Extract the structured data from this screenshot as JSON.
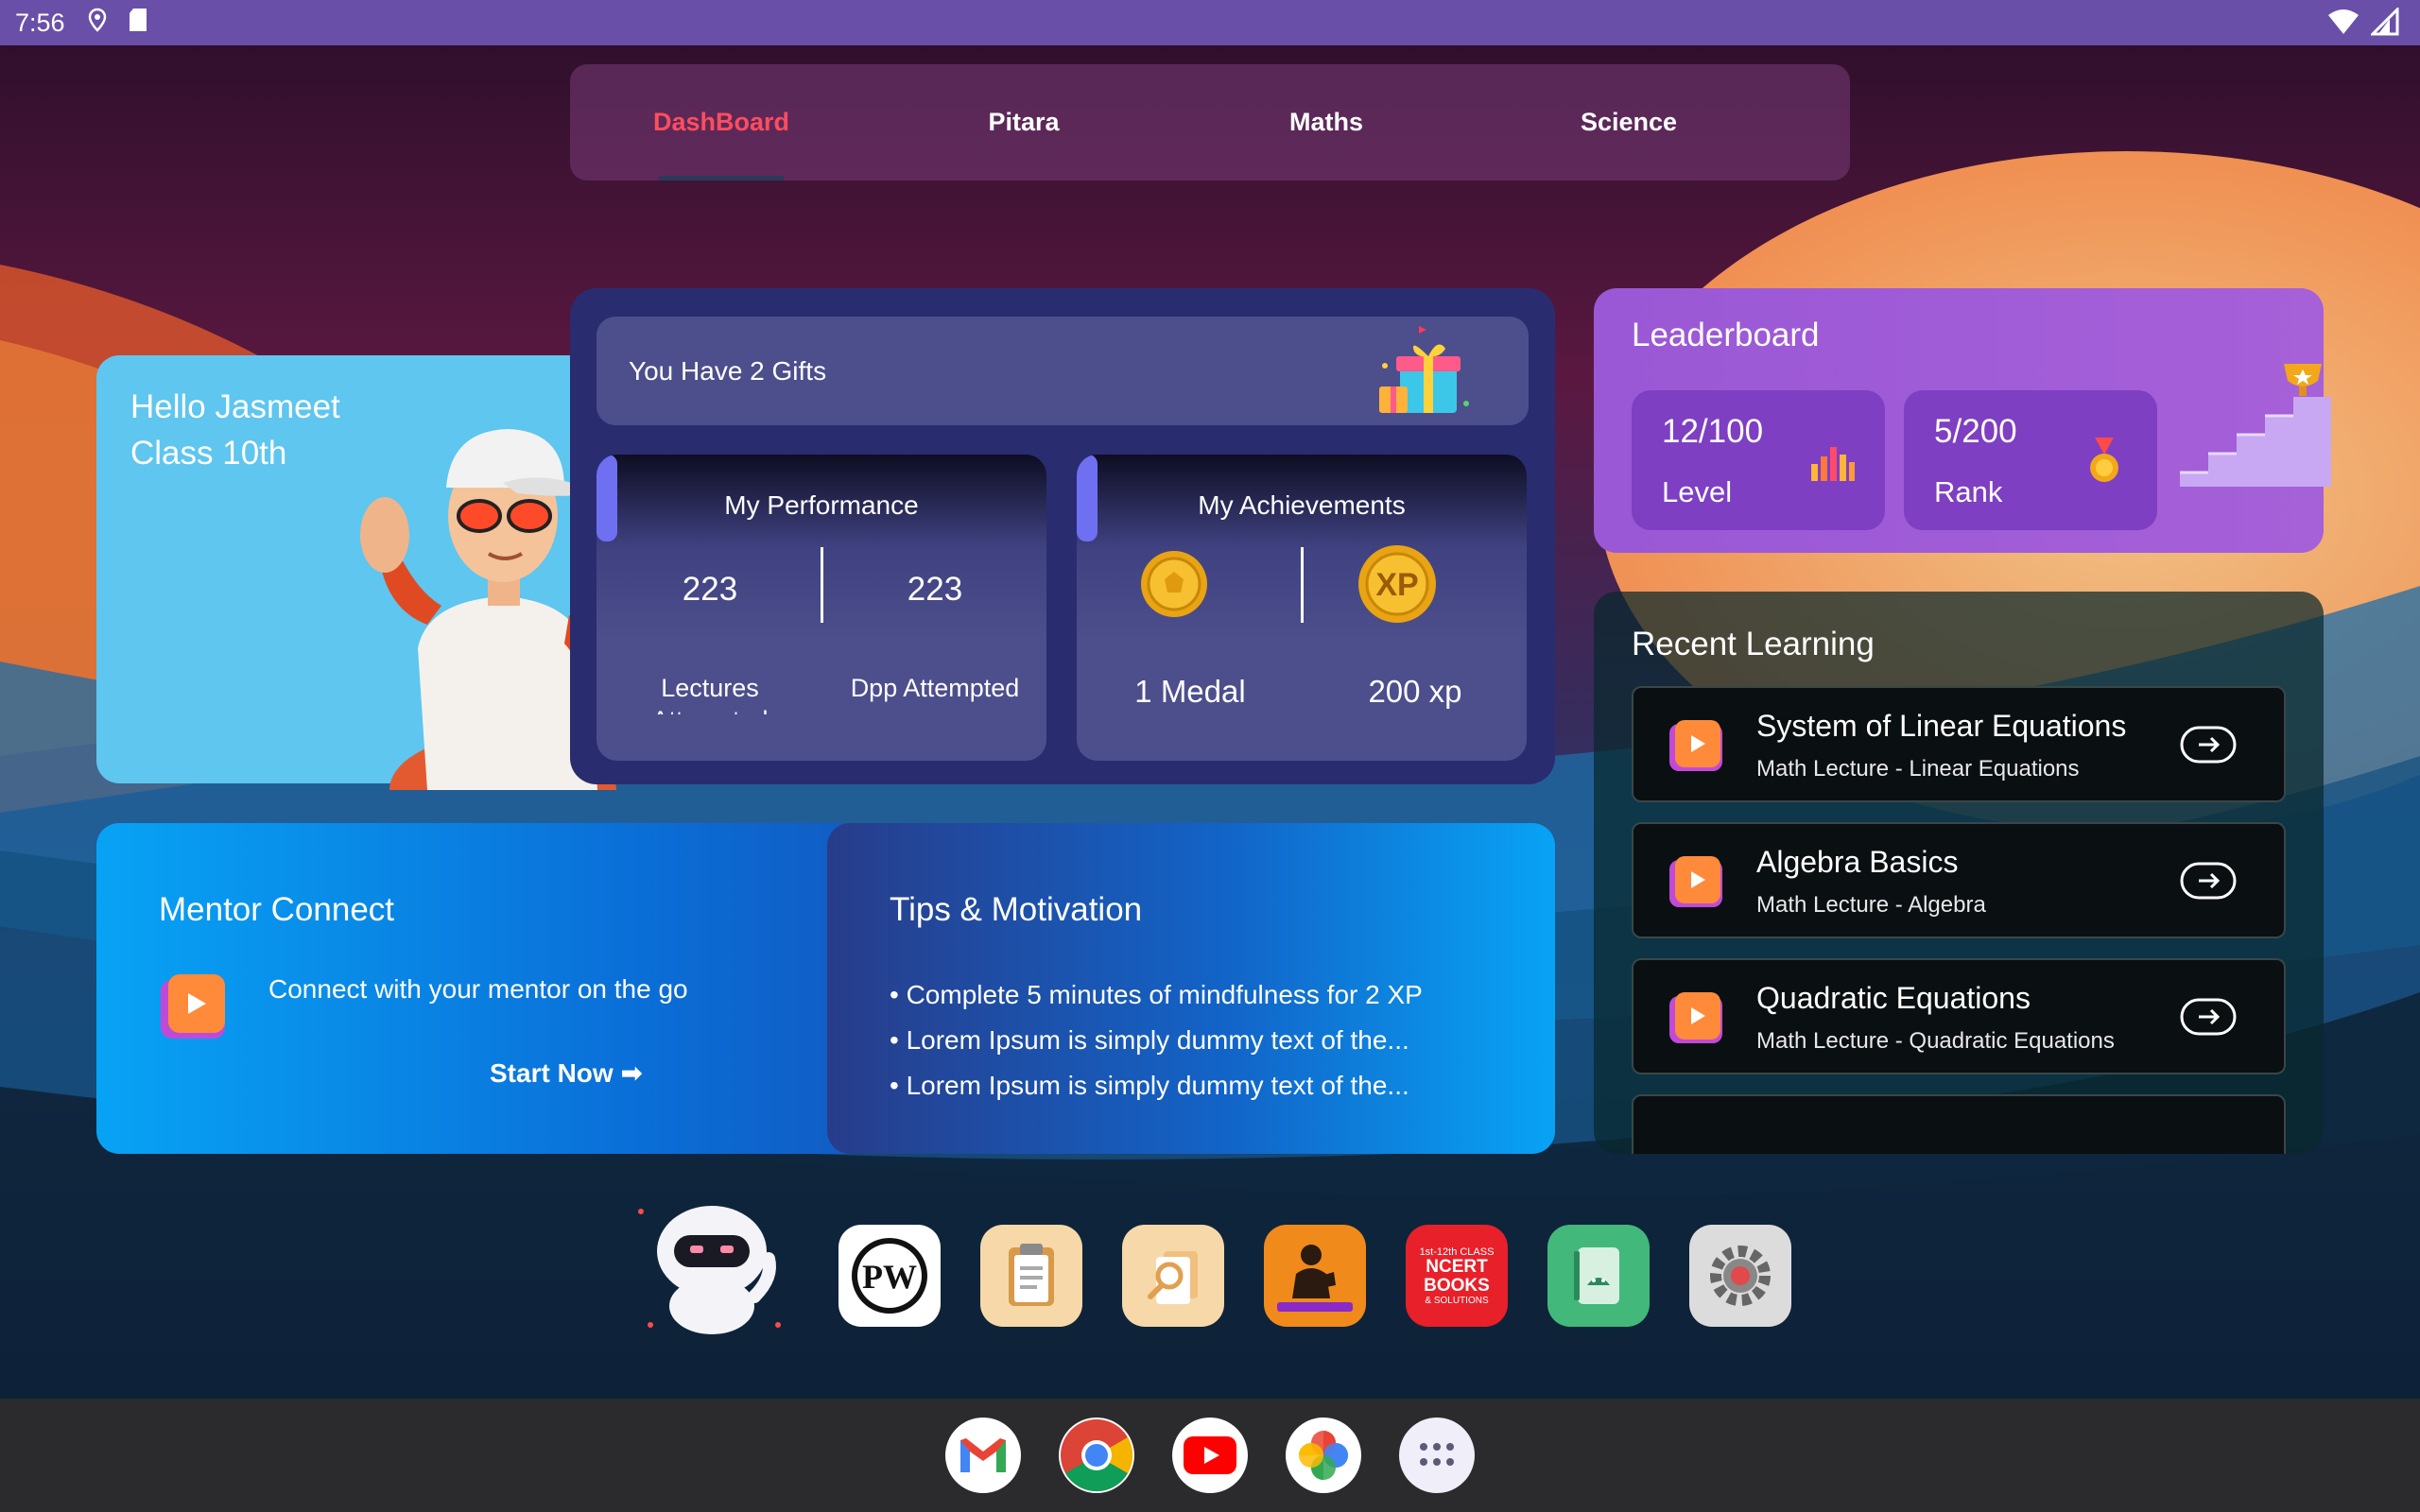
{
  "status_bar": {
    "time": "7:56",
    "left_icons": [
      "location-pin-icon",
      "sd-card-icon"
    ],
    "right_icons": [
      "wifi-icon",
      "signal-icon"
    ]
  },
  "tabs": [
    {
      "label": "DashBoard",
      "active": true
    },
    {
      "label": "Pitara",
      "active": false
    },
    {
      "label": "Maths",
      "active": false
    },
    {
      "label": "Science",
      "active": false
    }
  ],
  "hello": {
    "greeting": "Hello Jasmeet",
    "class_label": "Class 10th"
  },
  "gifts": {
    "text": "You Have 2 Gifts"
  },
  "performance": {
    "title": "My Performance",
    "lectures_value": "223",
    "lectures_label": "Lectures Attempted",
    "dpp_value": "223",
    "dpp_label": "Dpp Attempted"
  },
  "achievements": {
    "title": "My Achievements",
    "medal_label": "1 Medal",
    "xp_badge": "XP",
    "xp_label": "200 xp"
  },
  "leaderboard": {
    "title": "Leaderboard",
    "level_value": "12/100",
    "level_label": "Level",
    "rank_value": "5/200",
    "rank_label": "Rank"
  },
  "recent_learning": {
    "title": "Recent Learning",
    "items": [
      {
        "title": "System of Linear Equations",
        "subtitle": "Math Lecture - Linear Equations"
      },
      {
        "title": "Algebra Basics",
        "subtitle": "Math Lecture - Algebra"
      },
      {
        "title": "Quadratic Equations",
        "subtitle": "Math Lecture - Quadratic Equations"
      }
    ]
  },
  "mentor": {
    "title": "Mentor Connect",
    "text": "Connect with your mentor on the go",
    "button": "Start Now ➡"
  },
  "tips": {
    "title": "Tips & Motivation",
    "items": [
      "• Complete 5 minutes of mindfulness for 2 XP",
      "• Lorem Ipsum is simply dummy text of the...",
      "• Lorem Ipsum is simply dummy text of the..."
    ]
  },
  "apps": [
    {
      "name": "pw-app-icon",
      "label": "PW"
    },
    {
      "name": "notes-app-icon"
    },
    {
      "name": "search-docs-app-icon"
    },
    {
      "name": "reading-app-icon"
    },
    {
      "name": "ncert-books-app-icon",
      "line1": "1st-12th CLASS",
      "line2": "NCERT",
      "line3": "BOOKS",
      "line4": "& SOLUTIONS"
    },
    {
      "name": "android-book-app-icon"
    },
    {
      "name": "settings-app-icon"
    }
  ],
  "dock": [
    "gmail-icon",
    "chrome-icon",
    "youtube-icon",
    "photos-icon",
    "app-drawer-icon"
  ],
  "colors": {
    "status_bar": "#6a4fa8",
    "active_tab": "#ff4d5e",
    "hello_card": "#5ec6ef",
    "center_card": "#2a2c70",
    "leaderboard": "#9a58d6",
    "mentor": "#08a3f5"
  }
}
